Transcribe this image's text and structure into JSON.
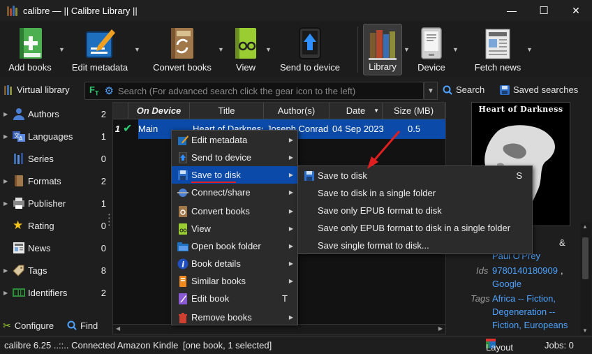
{
  "window": {
    "title": "calibre — || Calibre Library ||",
    "controls": {
      "minimize": "—",
      "maximize": "☐",
      "close": "✕"
    }
  },
  "toolbar": {
    "items": [
      {
        "label": "Add books",
        "icon": "add-book-icon"
      },
      {
        "label": "Edit metadata",
        "icon": "edit-metadata-icon"
      },
      {
        "label": "Convert books",
        "icon": "convert-books-icon"
      },
      {
        "label": "View",
        "icon": "view-book-icon"
      },
      {
        "label": "Send to device",
        "icon": "send-to-device-icon"
      },
      {
        "label": "Library",
        "icon": "library-icon"
      },
      {
        "label": "Device",
        "icon": "device-icon"
      },
      {
        "label": "Fetch news",
        "icon": "fetch-news-icon"
      }
    ]
  },
  "searchbar": {
    "virtual_library": "Virtual library",
    "placeholder": "Search (For advanced search click the gear icon to the left)",
    "search_label": "Search",
    "saved_searches_label": "Saved searches"
  },
  "sidebar": {
    "items": [
      {
        "label": "Authors",
        "count": "2",
        "icon": "authors-icon"
      },
      {
        "label": "Languages",
        "count": "1",
        "icon": "languages-icon"
      },
      {
        "label": "Series",
        "count": "0",
        "icon": "series-icon"
      },
      {
        "label": "Formats",
        "count": "2",
        "icon": "formats-icon"
      },
      {
        "label": "Publisher",
        "count": "1",
        "icon": "publisher-icon"
      },
      {
        "label": "Rating",
        "count": "0",
        "icon": "star-icon"
      },
      {
        "label": "News",
        "count": "0",
        "icon": "news-icon"
      },
      {
        "label": "Tags",
        "count": "8",
        "icon": "tags-icon"
      },
      {
        "label": "Identifiers",
        "count": "2",
        "icon": "identifiers-icon"
      }
    ],
    "configure_label": "Configure",
    "find_label": "Find"
  },
  "booklist": {
    "columns": [
      "On Device",
      "Title",
      "Author(s)",
      "Date",
      "Size (MB)"
    ],
    "rows": [
      {
        "num": "1",
        "on_device": "Main",
        "title": "Heart of Darkness",
        "authors": "Joseph Conrad",
        "date": "04 Sep 2023",
        "size": "0.5"
      }
    ]
  },
  "details": {
    "cover_title": "Heart of Darkness",
    "authors_tail": "onrad",
    "authors_amp": "&",
    "author2": "Paul O'Prey",
    "ids_label": "Ids",
    "isbn": "9780140180909",
    "ids_comma": ",",
    "google": "Google",
    "tags_label": "Tags",
    "tag1": "Africa -- Fiction,",
    "tag2": "Degeneration --",
    "tag3": "Fiction, Europeans"
  },
  "statusbar": {
    "left": "calibre 6.25 ..::.. Connected Amazon Kindle",
    "selection": "[one book, 1 selected]",
    "layout_label": "Layout",
    "jobs_label": "Jobs: 0"
  },
  "context_menu": {
    "items": [
      {
        "label": "Edit metadata",
        "shortcut": "",
        "arrow": true,
        "icon": "edit-metadata-icon"
      },
      {
        "label": "Send to device",
        "shortcut": "",
        "arrow": true,
        "icon": "send-to-device-icon"
      },
      {
        "label": "Save to disk",
        "shortcut": "",
        "arrow": true,
        "icon": "save-to-disk-icon"
      },
      {
        "label": "Connect/share",
        "shortcut": "",
        "arrow": true,
        "icon": "connect-share-icon"
      },
      {
        "label": "Convert books",
        "shortcut": "",
        "arrow": true,
        "icon": "convert-books-icon"
      },
      {
        "label": "View",
        "shortcut": "",
        "arrow": true,
        "icon": "view-book-icon"
      },
      {
        "label": "Open book folder",
        "shortcut": "",
        "arrow": true,
        "icon": "folder-icon"
      },
      {
        "label": "Book details",
        "shortcut": "",
        "arrow": true,
        "icon": "info-icon"
      },
      {
        "label": "Similar books",
        "shortcut": "",
        "arrow": true,
        "icon": "similar-books-icon"
      },
      {
        "label": "Edit book",
        "shortcut": "T",
        "arrow": false,
        "icon": "edit-book-icon"
      },
      {
        "label": "Remove books",
        "shortcut": "",
        "arrow": true,
        "icon": "trash-icon"
      }
    ]
  },
  "submenu": {
    "items": [
      {
        "label": "Save to disk",
        "shortcut": "S"
      },
      {
        "label": "Save to disk in a single folder",
        "shortcut": ""
      },
      {
        "label": "Save only EPUB format to disk",
        "shortcut": ""
      },
      {
        "label": "Save only EPUB format to disk in a single folder",
        "shortcut": ""
      },
      {
        "label": "Save single format to disk...",
        "shortcut": ""
      }
    ]
  },
  "colors": {
    "accent": "#0b4aa8",
    "link": "#4ea3ff",
    "annotation": "#e02020"
  }
}
